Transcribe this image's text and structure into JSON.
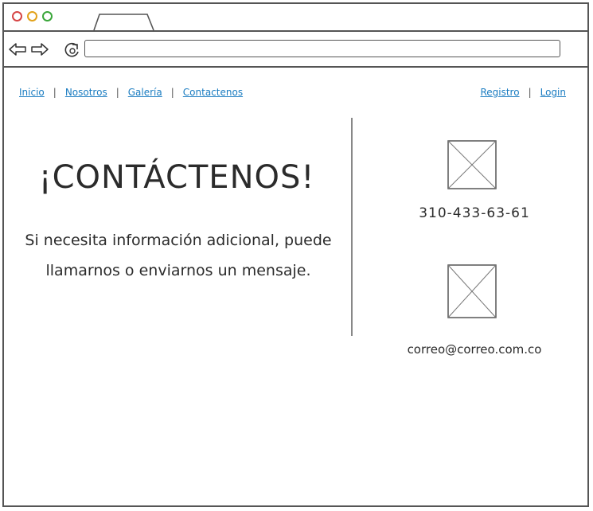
{
  "browser": {
    "address": ""
  },
  "nav": {
    "left": [
      "Inicio",
      "Nosotros",
      "Galería",
      "Contactenos"
    ],
    "right": [
      "Registro",
      "Login"
    ],
    "separator": "|"
  },
  "content": {
    "heading": "¡CONTÁCTENOS!",
    "paragraph": "Si necesita información adicional, puede llamarnos o enviarnos un mensaje."
  },
  "contact": {
    "phone": "310-433-63-61",
    "email": "correo@correo.com.co"
  },
  "icons": {
    "back": "arrow-left-icon",
    "forward": "arrow-right-icon",
    "reload": "reload-icon",
    "placeholder": "image-placeholder-icon"
  },
  "colors": {
    "link": "#1a7cc1",
    "close": "#d64545",
    "minimize": "#e2a21a",
    "maximize": "#3aa63a"
  }
}
